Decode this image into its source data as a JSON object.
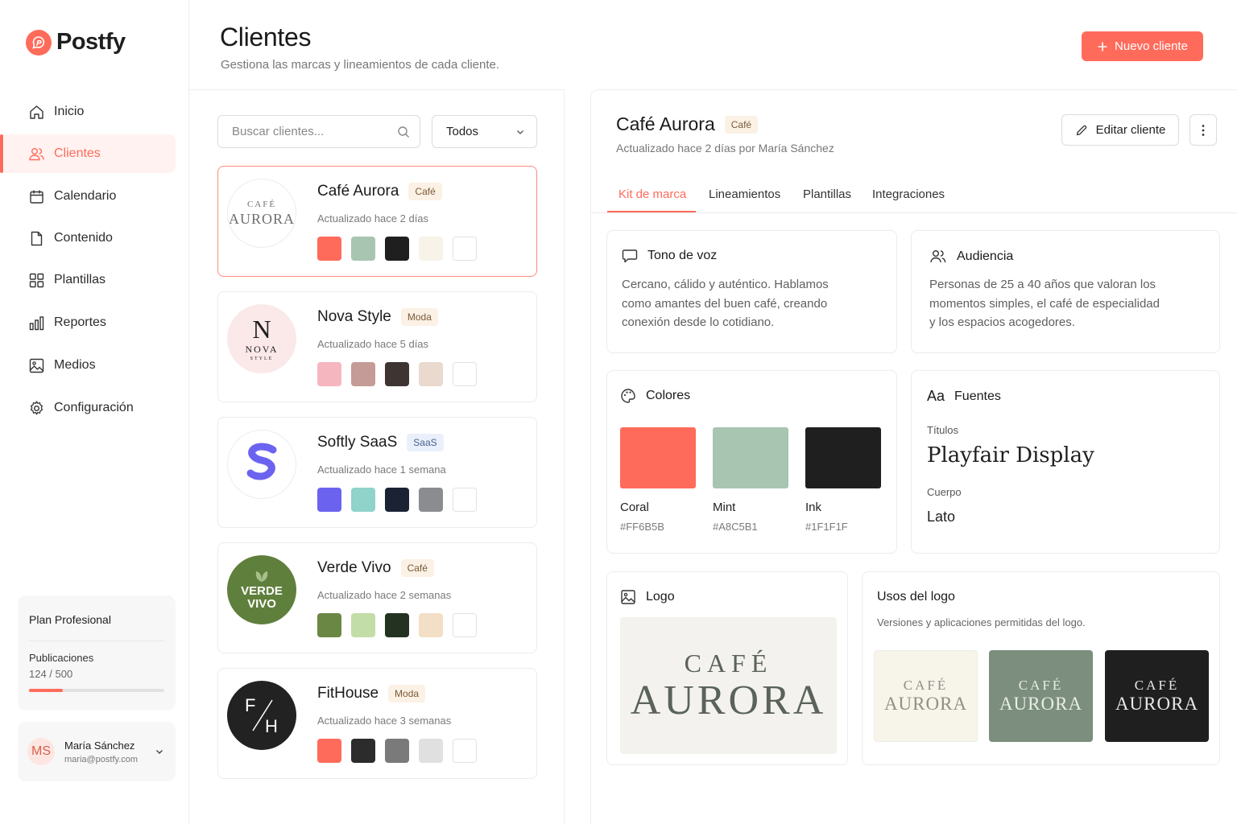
{
  "brand": {
    "name": "Postfy",
    "accent": "#FF6B5B"
  },
  "nav": [
    {
      "label": "Inicio",
      "icon": "home-icon"
    },
    {
      "label": "Clientes",
      "icon": "users-icon",
      "active": true
    },
    {
      "label": "Calendario",
      "icon": "calendar-icon"
    },
    {
      "label": "Contenido",
      "icon": "document-icon"
    },
    {
      "label": "Plantillas",
      "icon": "grid-icon"
    },
    {
      "label": "Reportes",
      "icon": "bar-chart-icon"
    },
    {
      "label": "Medios",
      "icon": "image-icon"
    },
    {
      "label": "Configuración",
      "icon": "gear-icon"
    }
  ],
  "plan": {
    "title": "Plan Profesional",
    "label": "Publicaciones",
    "count": "124 / 500",
    "progress": 0.248
  },
  "user": {
    "initials": "MS",
    "name": "María Sánchez",
    "email": "maria@postfy.com"
  },
  "header": {
    "title": "Clientes",
    "subtitle": "Gestiona las marcas y lineamientos de cada cliente.",
    "new_button": "Nuevo cliente"
  },
  "filters": {
    "search_placeholder": "Buscar clientes...",
    "select_value": "Todos"
  },
  "clients": [
    {
      "name": "Café Aurora",
      "tag": "Café",
      "meta": "Actualizado hace 2 días",
      "logo_line1": "CAFÉ",
      "logo_line2": "AURORA",
      "swatches": [
        "#FF6B5B",
        "#A8C5B1",
        "#1F1F1F",
        "#F7F3E8",
        "#FFFFFF"
      ]
    },
    {
      "name": "Nova Style",
      "tag": "Moda",
      "meta": "Actualizado hace 5 días",
      "logo_line1": "N",
      "logo_line2": "NOVA",
      "logo_line3": "STYLE",
      "swatches": [
        "#F6B6C0",
        "#C49B97",
        "#3E3533",
        "#EAD9CF",
        "#FFFFFF"
      ]
    },
    {
      "name": "Softly SaaS",
      "tag": "SaaS",
      "meta": "Actualizado hace 1 semana",
      "swatches": [
        "#6B63F0",
        "#8FD3CB",
        "#1A2233",
        "#8A8C90",
        "#FFFFFF"
      ]
    },
    {
      "name": "Verde Vivo",
      "tag": "Café",
      "meta": "Actualizado hace 2 semanas",
      "logo_line1": "VERDE",
      "logo_line2": "VIVO",
      "swatches": [
        "#6B8744",
        "#C3DDA8",
        "#243222",
        "#F3DFC6",
        "#FFFFFF"
      ]
    },
    {
      "name": "FitHouse",
      "tag": "Moda",
      "meta": "Actualizado hace 3 semanas",
      "logo_line1": "F",
      "logo_line2": "H",
      "swatches": [
        "#FF6B5B",
        "#2C2C2C",
        "#7A7A7A",
        "#E0E0E0",
        "#FFFFFF"
      ]
    }
  ],
  "detail": {
    "name": "Café Aurora",
    "tag": "Café",
    "meta": "Actualizado hace 2 días por María Sánchez",
    "edit_button": "Editar cliente",
    "tabs": [
      "Kit de marca",
      "Lineamientos",
      "Plantillas",
      "Integraciones"
    ],
    "tone": {
      "title": "Tono de voz",
      "lines": [
        "Cercano, cálido y auténtico. Hablamos",
        "como amantes del buen café, creando",
        "conexión desde lo cotidiano."
      ]
    },
    "audience": {
      "title": "Audiencia",
      "lines": [
        "Personas de 25 a 40 años que valoran los",
        "momentos simples, el café de especialidad",
        "y los espacios acogedores."
      ]
    },
    "colors": {
      "title": "Colores",
      "items": [
        {
          "name": "Coral",
          "hex": "#FF6B5B"
        },
        {
          "name": "Mint",
          "hex": "#A8C5B1"
        },
        {
          "name": "Ink",
          "hex": "#1F1F1F"
        }
      ]
    },
    "fonts": {
      "title": "Fuentes",
      "icon_text": "Aa",
      "titles_label": "Títulos",
      "titles_font": "Playfair Display",
      "body_label": "Cuerpo",
      "body_font": "Lato"
    },
    "logo": {
      "title": "Logo",
      "line1": "CAFÉ",
      "line2": "AURORA"
    },
    "usage": {
      "title": "Usos del logo",
      "subtitle": "Versiones y aplicaciones permitidas del logo.",
      "variants": [
        {
          "line1": "CAFÉ",
          "line2": "AURORA",
          "bg": "#F7F4EA",
          "fg": "#8F8F86"
        },
        {
          "line1": "CAFÉ",
          "line2": "AURORA",
          "bg": "#7C8E7E",
          "fg": "#E9EEE6"
        },
        {
          "line1": "CAFÉ",
          "line2": "AURORA",
          "bg": "#1F1F1F",
          "fg": "#E8E8E8"
        }
      ]
    }
  }
}
